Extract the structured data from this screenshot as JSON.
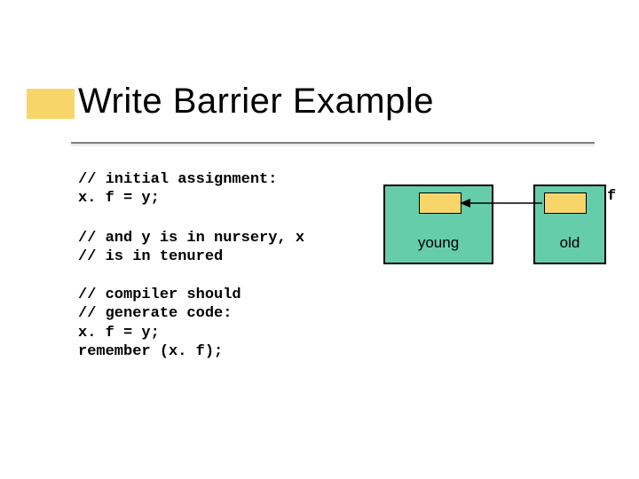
{
  "title": "Write Barrier Example",
  "code": {
    "block1": "// initial assignment:\nx. f = y;",
    "block2": "// and y is in nursery, x\n// is in tenured",
    "block3": "// compiler should\n// generate code:\nx. f = y;\nremember (x. f);"
  },
  "boxes": {
    "young": "young",
    "old": "old"
  },
  "pointer_label": "f",
  "colors": {
    "accent": "#f8d568",
    "box_fill": "#66cdaa"
  }
}
